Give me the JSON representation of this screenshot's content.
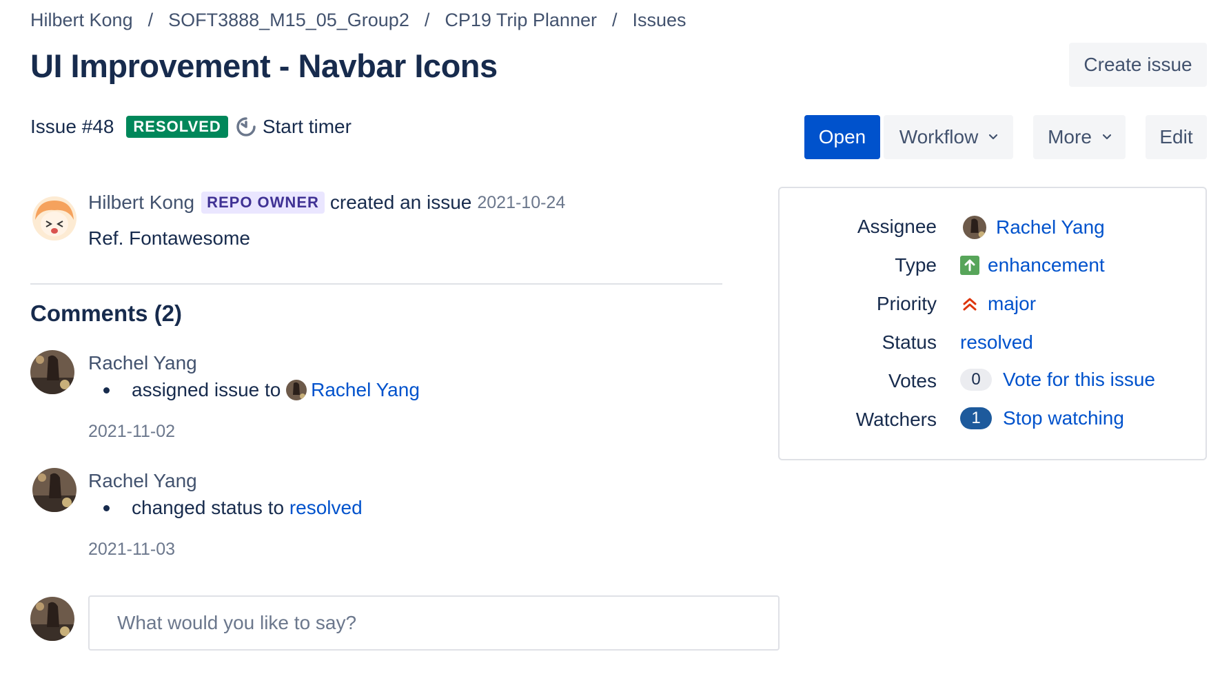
{
  "breadcrumb": {
    "items": [
      "Hilbert Kong",
      "SOFT3888_M15_05_Group2",
      "CP19 Trip Planner",
      "Issues"
    ],
    "separator": "/"
  },
  "page_title": "UI Improvement - Navbar Icons",
  "header_actions": {
    "create_issue": "Create issue",
    "open": "Open",
    "workflow": "Workflow",
    "more": "More",
    "edit": "Edit"
  },
  "issue": {
    "number": "Issue #48",
    "status_lozenge": "RESOLVED",
    "start_timer": "Start timer",
    "created_by": "Hilbert Kong",
    "role_badge": "REPO OWNER",
    "created_text": "created an issue",
    "created_date": "2021-10-24",
    "description": "Ref. Fontawesome"
  },
  "comments": {
    "title": "Comments (2)",
    "items": [
      {
        "author": "Rachel Yang",
        "change_text": "assigned issue to",
        "change_target": "Rachel Yang",
        "date": "2021-11-02"
      },
      {
        "author": "Rachel Yang",
        "change_text": "changed status to",
        "change_target": "resolved",
        "date": "2021-11-03"
      }
    ],
    "input_placeholder": "What would you like to say?"
  },
  "details": {
    "assignee": {
      "label": "Assignee",
      "value": "Rachel Yang"
    },
    "type": {
      "label": "Type",
      "value": "enhancement",
      "icon": "arrow-up-icon"
    },
    "priority": {
      "label": "Priority",
      "value": "major",
      "icon": "double-chevron-up-icon"
    },
    "status": {
      "label": "Status",
      "value": "resolved"
    },
    "votes": {
      "label": "Votes",
      "count": "0",
      "action": "Vote for this issue"
    },
    "watchers": {
      "label": "Watchers",
      "count": "1",
      "action": "Stop watching"
    }
  },
  "colors": {
    "primary": "#0052cc",
    "resolved_green": "#00875a",
    "repo_owner_bg": "#eae6ff",
    "repo_owner_text": "#403294",
    "priority_red": "#de350b",
    "type_green": "#57a55a",
    "watch_badge": "#1d5a9c"
  }
}
